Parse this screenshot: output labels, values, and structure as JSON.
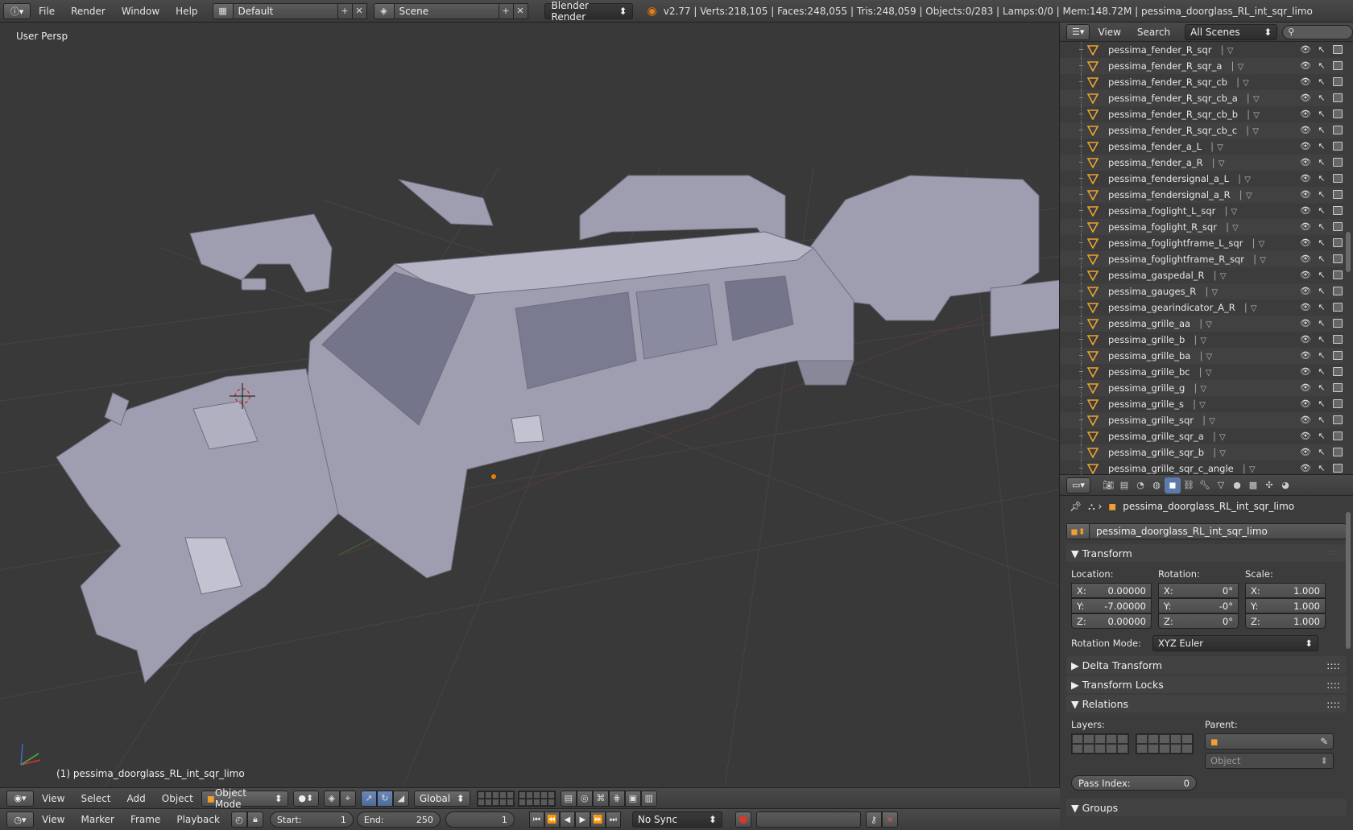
{
  "topbar": {
    "menus": [
      "File",
      "Render",
      "Window",
      "Help"
    ],
    "layout": "Default",
    "scene": "Scene",
    "engine": "Blender Render",
    "stats": "v2.77 | Verts:218,105 | Faces:248,055 | Tris:248,059 | Objects:0/283 | Lamps:0/0 | Mem:148.72M | pessima_doorglass_RL_int_sqr_limo"
  },
  "viewport": {
    "label": "User Persp",
    "object_name": "(1) pessima_doorglass_RL_int_sqr_limo"
  },
  "vpheader": {
    "menus": [
      "View",
      "Select",
      "Add",
      "Object"
    ],
    "mode": "Object Mode",
    "orientation": "Global"
  },
  "timeline": {
    "menus": [
      "View",
      "Marker",
      "Frame",
      "Playback"
    ],
    "start_label": "Start:",
    "start": "1",
    "end_label": "End:",
    "end": "250",
    "current": "1",
    "sync": "No Sync"
  },
  "outliner": {
    "menus": [
      "View",
      "Search"
    ],
    "scenes": "All Scenes",
    "items": [
      "pessima_fender_R_sqr",
      "pessima_fender_R_sqr_a",
      "pessima_fender_R_sqr_cb",
      "pessima_fender_R_sqr_cb_a",
      "pessima_fender_R_sqr_cb_b",
      "pessima_fender_R_sqr_cb_c",
      "pessima_fender_a_L",
      "pessima_fender_a_R",
      "pessima_fendersignal_a_L",
      "pessima_fendersignal_a_R",
      "pessima_foglight_L_sqr",
      "pessima_foglight_R_sqr",
      "pessima_foglightframe_L_sqr",
      "pessima_foglightframe_R_sqr",
      "pessima_gaspedal_R",
      "pessima_gauges_R",
      "pessima_gearindicator_A_R",
      "pessima_grille_aa",
      "pessima_grille_b",
      "pessima_grille_ba",
      "pessima_grille_bc",
      "pessima_grille_g",
      "pessima_grille_s",
      "pessima_grille_sqr",
      "pessima_grille_sqr_a",
      "pessima_grille_sqr_b",
      "pessima_grille_sqr_c_angle"
    ]
  },
  "props": {
    "breadcrumb": "pessima_doorglass_RL_int_sqr_limo",
    "object_name": "pessima_doorglass_RL_int_sqr_limo",
    "transform": {
      "title": "Transform",
      "location_label": "Location:",
      "rotation_label": "Rotation:",
      "scale_label": "Scale:",
      "loc": [
        [
          "X:",
          "0.00000"
        ],
        [
          "Y:",
          "-7.00000"
        ],
        [
          "Z:",
          "0.00000"
        ]
      ],
      "rot": [
        [
          "X:",
          "0°"
        ],
        [
          "Y:",
          "-0°"
        ],
        [
          "Z:",
          "0°"
        ]
      ],
      "scale": [
        [
          "X:",
          "1.000"
        ],
        [
          "Y:",
          "1.000"
        ],
        [
          "Z:",
          "1.000"
        ]
      ],
      "rotation_mode_label": "Rotation Mode:",
      "rotation_mode": "XYZ Euler"
    },
    "delta_transform": "Delta Transform",
    "transform_locks": "Transform Locks",
    "relations": {
      "title": "Relations",
      "layers_label": "Layers:",
      "parent_label": "Parent:",
      "parent_type": "Object",
      "pass_index_label": "Pass Index:",
      "pass_index": "0"
    },
    "groups": "Groups"
  },
  "colors": {
    "accent_orange": "#e87d0d",
    "selection_blue": "#5e7aaa",
    "viewport_bg": "#393939",
    "mesh_color": "#a8a8b8"
  }
}
